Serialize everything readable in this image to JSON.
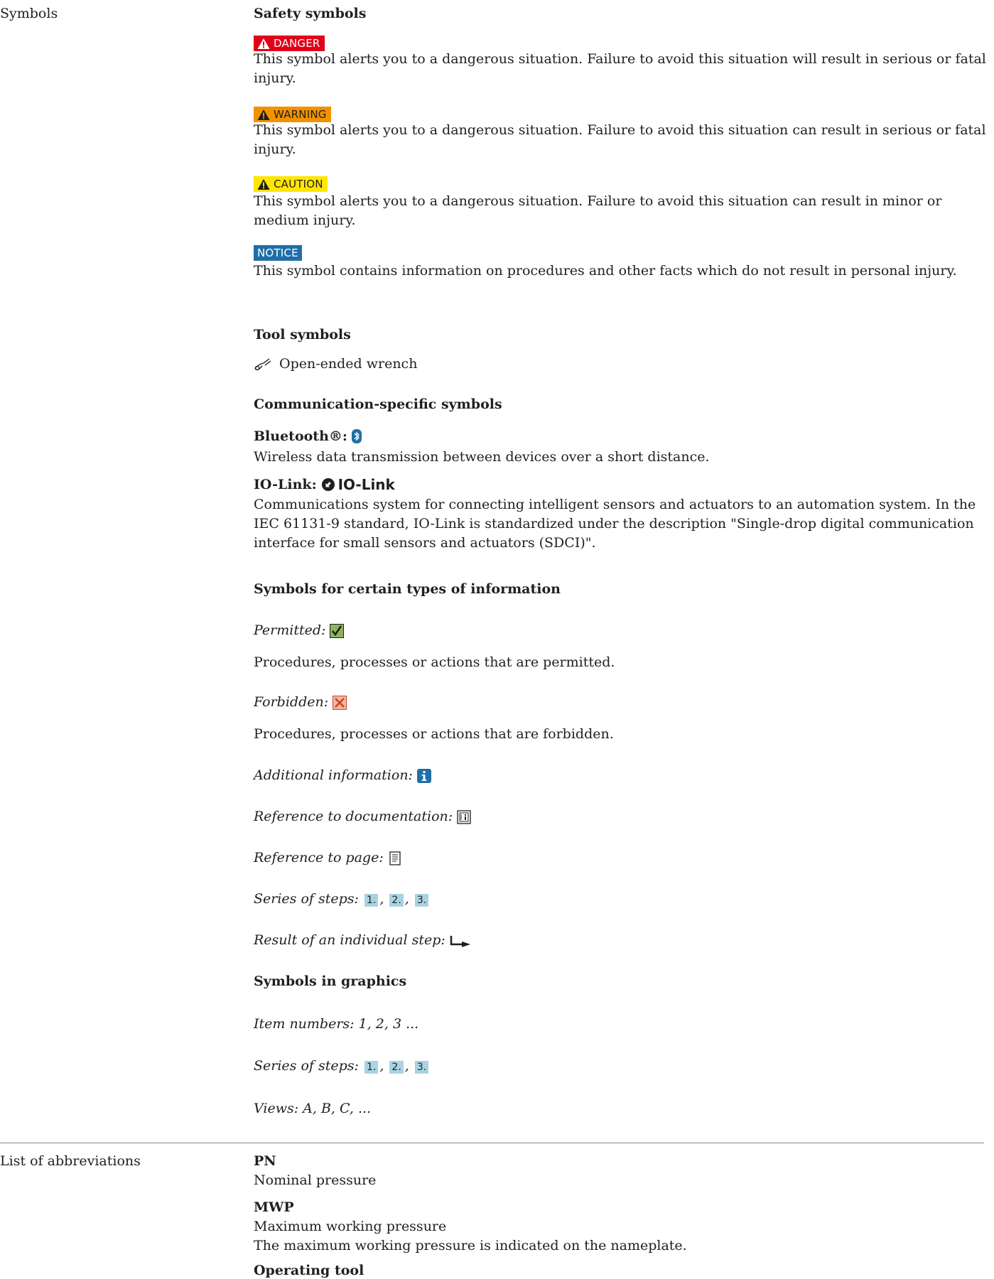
{
  "sections": {
    "symbols_label": "Symbols",
    "abbrev_label": "List of abbreviations"
  },
  "safety": {
    "heading": "Safety symbols",
    "danger_label": "DANGER",
    "danger_text": "This symbol alerts you to a dangerous situation. Failure to avoid this situation will result in serious or fatal injury.",
    "warning_label": "WARNING",
    "warning_text": "This symbol alerts you to a dangerous situation. Failure to avoid this situation can result in serious or fatal injury.",
    "caution_label": "CAUTION",
    "caution_text": "This symbol alerts you to a dangerous situation. Failure to avoid this situation can result in minor or medium injury.",
    "notice_label": "NOTICE",
    "notice_text": "This symbol contains information on procedures and other facts which do not result in personal injury."
  },
  "tools": {
    "heading": "Tool symbols",
    "wrench": "Open-ended wrench"
  },
  "comm": {
    "heading": "Communication-specific symbols",
    "bt_label": "Bluetooth®:",
    "bt_text": "Wireless data transmission between devices over a short distance.",
    "io_label": "IO-Link:",
    "io_logo_text": "IO-Link",
    "io_text": "Communications system for connecting intelligent sensors and actuators to an automation system. In the IEC 61131-9 standard, IO-Link is standardized under the description \"Single-drop digital communication interface for small sensors and actuators (SDCI)\"."
  },
  "info": {
    "heading": "Symbols for certain types of information",
    "permitted_label": "Permitted:",
    "permitted_text": "Procedures, processes or actions that are permitted.",
    "forbidden_label": "Forbidden:",
    "forbidden_text": "Procedures, processes or actions that are forbidden.",
    "additional": "Additional information:",
    "ref_doc": "Reference to documentation:",
    "ref_page": "Reference to page:",
    "steps_label": "Series of steps:",
    "step1": "1.",
    "step2": "2.",
    "step3": "3.",
    "sep": ",",
    "result": "Result of an individual step:"
  },
  "graphics": {
    "heading": "Symbols in graphics",
    "items": "Item numbers: 1, 2, 3 ...",
    "steps_label": "Series of steps:",
    "views": "Views: A, B, C, ..."
  },
  "abbrev": {
    "pn": "PN",
    "pn_text": "Nominal pressure",
    "mwp": "MWP",
    "mwp_text": "Maximum working pressure",
    "mwp_text2": "The maximum working pressure is indicated on the nameplate.",
    "operating_tool": "Operating tool"
  },
  "colors": {
    "danger": "#e2001a",
    "warning": "#f39200",
    "caution": "#ffe600",
    "notice": "#1f6ea8",
    "step_bg": "#a9d3e3"
  }
}
